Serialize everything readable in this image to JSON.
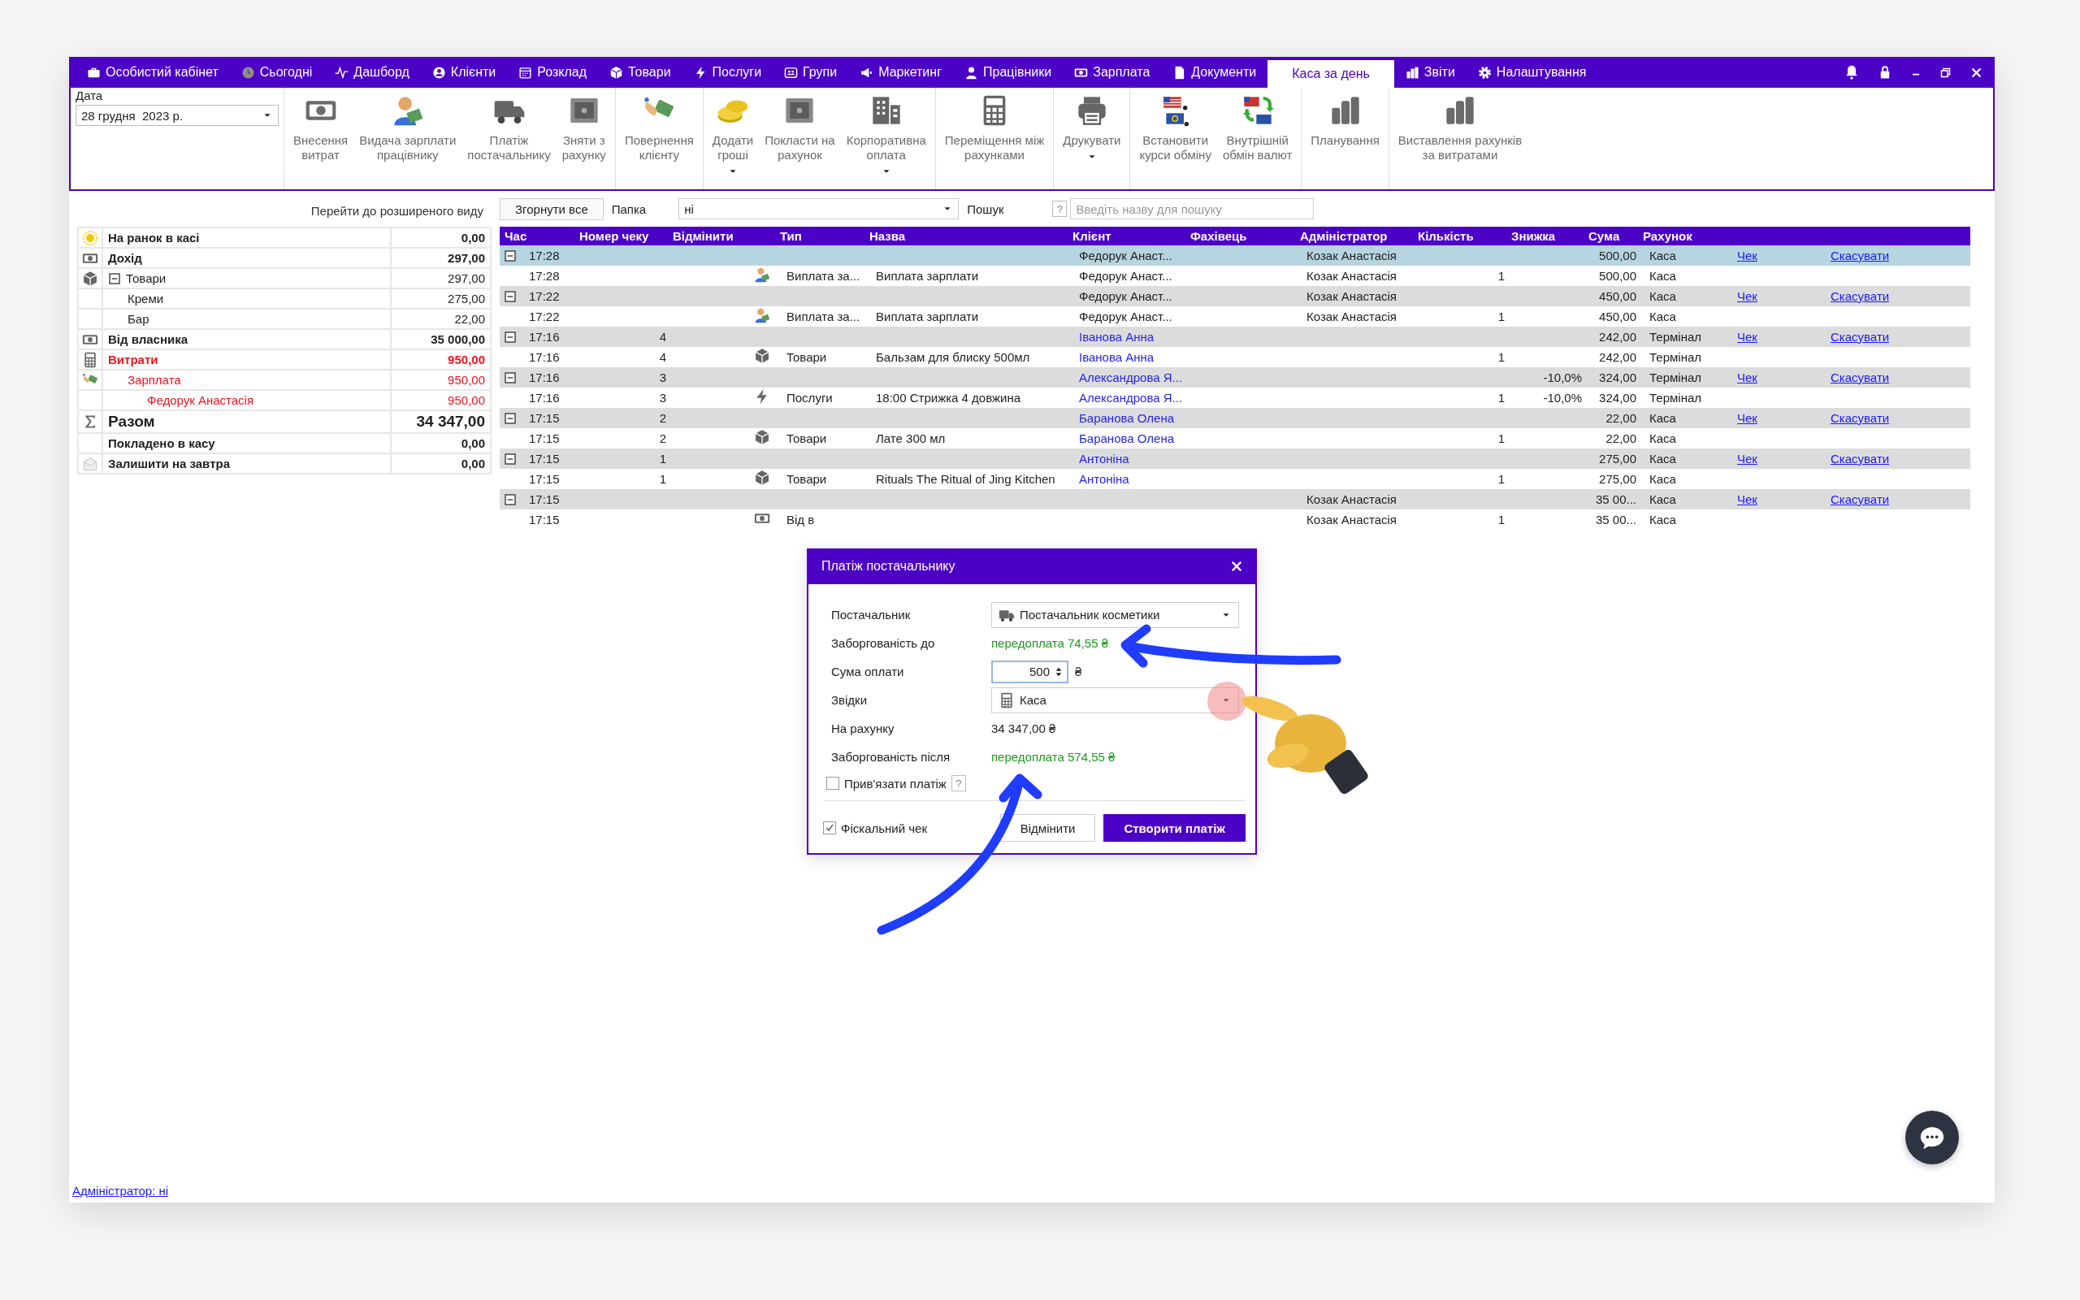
{
  "nav": [
    {
      "label": "Особистий кабінет",
      "selected": false
    },
    {
      "label": "Сьогодні",
      "selected": false
    },
    {
      "label": "Дашборд",
      "selected": false
    },
    {
      "label": "Клієнти",
      "selected": false
    },
    {
      "label": "Розклад",
      "selected": false
    },
    {
      "label": "Товари",
      "selected": false
    },
    {
      "label": "Послуги",
      "selected": false
    },
    {
      "label": "Групи",
      "selected": false
    },
    {
      "label": "Маркетинг",
      "selected": false
    },
    {
      "label": "Працівники",
      "selected": false
    },
    {
      "label": "Зарплата",
      "selected": false
    },
    {
      "label": "Документи",
      "selected": false
    },
    {
      "label": "Каса за день",
      "selected": true
    },
    {
      "label": "Звіти",
      "selected": false
    },
    {
      "label": "Налаштування",
      "selected": false
    }
  ],
  "toolbar": {
    "date_label": "Дата",
    "date": "28 грудня  2023 р.",
    "groups": [
      [
        {
          "label": "Внесення\nвитрат",
          "dropdown": false
        },
        {
          "label": "Видача зарплати\nпрацівнику",
          "dropdown": false
        },
        {
          "label": "Платіж\nпостачальнику",
          "dropdown": false
        },
        {
          "label": "Зняти з\nрахунку",
          "dropdown": false
        }
      ],
      [
        {
          "label": "Повернення\nклієнту",
          "dropdown": false
        }
      ],
      [
        {
          "label": "Додати\nгроші",
          "dropdown": true
        },
        {
          "label": "Покласти на\nрахунок",
          "dropdown": false
        },
        {
          "label": "Корпоративна\nоплата",
          "dropdown": true
        }
      ],
      [
        {
          "label": "Переміщення між\nрахунками",
          "dropdown": false
        }
      ],
      [
        {
          "label": "Друкувати",
          "dropdown": true
        }
      ],
      [
        {
          "label": "Встановити\nкурси обміну",
          "dropdown": false
        },
        {
          "label": "Внутрішній\nобмін валют",
          "dropdown": false
        }
      ],
      [
        {
          "label": "Планування",
          "dropdown": false
        }
      ],
      [
        {
          "label": "Виставлення рахунків\nза витратами",
          "dropdown": false
        }
      ]
    ]
  },
  "extended_view_link": "Перейти до розширеного виду",
  "summary": {
    "rows": [
      {
        "kind": "line",
        "label": "На ранок в касі",
        "value": "0,00",
        "bold": true,
        "red": false
      },
      {
        "kind": "line",
        "label": "Дохід",
        "value": "297,00",
        "bold": true,
        "red": false
      },
      {
        "kind": "line",
        "label": "Товари",
        "value": "297,00",
        "bold": false,
        "red": false,
        "expanded": true,
        "children": [
          {
            "kind": "line",
            "label": "Креми",
            "value": "275,00",
            "bold": false,
            "red": false
          },
          {
            "kind": "line",
            "label": "Бар",
            "value": "22,00",
            "bold": false,
            "red": false
          }
        ]
      },
      {
        "kind": "line",
        "label": "Від власника",
        "value": "35 000,00",
        "bold": true,
        "red": false
      },
      {
        "kind": "line",
        "label": "Витрати",
        "value": "950,00",
        "bold": true,
        "red": true,
        "children": [
          {
            "kind": "line",
            "label": "Зарплата",
            "value": "950,00",
            "bold": false,
            "red": true,
            "children": [
              {
                "kind": "line",
                "label": "Федорук Анастасія",
                "value": "950,00",
                "bold": false,
                "red": true
              }
            ]
          }
        ]
      },
      {
        "kind": "total",
        "label": "Разом",
        "value": "34 347,00",
        "bold": true,
        "red": false
      },
      {
        "kind": "line",
        "label": "Покладено в касу",
        "value": "0,00",
        "bold": true,
        "red": false
      },
      {
        "kind": "line",
        "label": "Залишити на завтра",
        "value": "0,00",
        "bold": true,
        "red": false
      }
    ]
  },
  "filter": {
    "collapse_all": "Згорнути все",
    "folder_label": "Папка",
    "folder": "ні",
    "search_label": "Пошук",
    "help": "?",
    "search_placeholder": "Введіть назву для пошуку"
  },
  "table": {
    "columns": [
      "Час",
      "Номер чеку",
      "Відмінити",
      "Тип",
      "Назва",
      "Клієнт",
      "Фахівець",
      "Адміністратор",
      "Кількість",
      "Знижка",
      "Сума",
      "Рахунок"
    ],
    "rows": [
      {
        "kind": "group",
        "expanded": true,
        "selected": true,
        "time": "17:28",
        "client": "Федорук Анаст...",
        "client_linked": false,
        "admin": "Козак Анастасія",
        "sum": "500,00",
        "account": "Каса",
        "check": "Чек",
        "cancel": "Скасувати"
      },
      {
        "kind": "item",
        "selected": false,
        "time": "17:28",
        "type": "Виплата за...",
        "name": "Виплата зарплати",
        "client": "Федорук Анаст...",
        "client_linked": false,
        "admin": "Козак Анастасія",
        "qty": "1",
        "sum": "500,00",
        "account": "Каса"
      },
      {
        "kind": "group",
        "expanded": true,
        "selected": false,
        "time": "17:22",
        "client": "Федорук Анаст...",
        "client_linked": false,
        "admin": "Козак Анастасія",
        "sum": "450,00",
        "account": "Каса",
        "check": "Чек",
        "cancel": "Скасувати"
      },
      {
        "kind": "item",
        "selected": false,
        "time": "17:22",
        "type": "Виплата за...",
        "name": "Виплата зарплати",
        "client": "Федорук Анаст...",
        "client_linked": false,
        "admin": "Козак Анастасія",
        "qty": "1",
        "sum": "450,00",
        "account": "Каса"
      },
      {
        "kind": "group",
        "expanded": true,
        "selected": false,
        "time": "17:16",
        "receipt": "4",
        "client": "Іванова Анна",
        "client_linked": true,
        "sum": "242,00",
        "account": "Термінал",
        "check": "Чек",
        "cancel": "Скасувати"
      },
      {
        "kind": "item",
        "selected": false,
        "time": "17:16",
        "receipt": "4",
        "type": "Товари",
        "name": "Бальзам для блиску 500мл",
        "client": "Іванова Анна",
        "client_linked": true,
        "qty": "1",
        "sum": "242,00",
        "account": "Термінал"
      },
      {
        "kind": "group",
        "expanded": true,
        "selected": false,
        "time": "17:16",
        "receipt": "3",
        "client": "Александрова Я...",
        "client_linked": true,
        "discount": "-10,0%",
        "sum": "324,00",
        "account": "Термінал",
        "check": "Чек",
        "cancel": "Скасувати"
      },
      {
        "kind": "item",
        "selected": false,
        "time": "17:16",
        "receipt": "3",
        "type": "Послуги",
        "name": "18:00 Стрижка 4 довжина",
        "client": "Александрова Я...",
        "client_linked": true,
        "qty": "1",
        "discount": "-10,0%",
        "sum": "324,00",
        "account": "Термінал"
      },
      {
        "kind": "group",
        "expanded": true,
        "selected": false,
        "time": "17:15",
        "receipt": "2",
        "client": "Баранова Олена",
        "client_linked": true,
        "sum": "22,00",
        "account": "Каса",
        "check": "Чек",
        "cancel": "Скасувати"
      },
      {
        "kind": "item",
        "selected": false,
        "time": "17:15",
        "receipt": "2",
        "type": "Товари",
        "name": "Лате 300 мл",
        "client": "Баранова Олена",
        "client_linked": true,
        "qty": "1",
        "sum": "22,00",
        "account": "Каса"
      },
      {
        "kind": "group",
        "expanded": true,
        "selected": false,
        "time": "17:15",
        "receipt": "1",
        "client": "Антоніна",
        "client_linked": true,
        "sum": "275,00",
        "account": "Каса",
        "check": "Чек",
        "cancel": "Скасувати"
      },
      {
        "kind": "item",
        "selected": false,
        "time": "17:15",
        "receipt": "1",
        "type": "Товари",
        "name": "Rituals The Ritual of Jing Kitchen",
        "client": "Антоніна",
        "client_linked": true,
        "qty": "1",
        "sum": "275,00",
        "account": "Каса"
      },
      {
        "kind": "group",
        "expanded": true,
        "selected": false,
        "time": "17:15",
        "admin": "Козак Анастасія",
        "sum": "35 00...",
        "account": "Каса",
        "check": "Чек",
        "cancel": "Скасувати"
      },
      {
        "kind": "item",
        "selected": false,
        "time": "17:15",
        "type": "Від в",
        "admin": "Козак Анастасія",
        "qty": "1",
        "sum": "35 00...",
        "account": "Каса"
      }
    ]
  },
  "dialog": {
    "title": "Платіж постачальнику",
    "fields": [
      {
        "kind": "select",
        "label": "Постачальник",
        "value": "Постачальник косметики"
      },
      {
        "kind": "note",
        "label": "Заборгованість до",
        "value": "передоплата 74,55 ₴"
      },
      {
        "kind": "spin",
        "label": "Сума оплати",
        "value": "500",
        "unit": "₴"
      },
      {
        "kind": "select",
        "label": "Звідки",
        "value": "Каса"
      },
      {
        "kind": "text",
        "label": "На рахунку",
        "value": "34 347,00 ₴"
      },
      {
        "kind": "note",
        "label": "Заборгованість після",
        "value": "передоплата 574,55 ₴"
      }
    ],
    "bind_payment": {
      "label": "Прив'язати платіж",
      "checked": false,
      "help": "?"
    },
    "fiscal_receipt": {
      "label": "Фіскальний чек",
      "checked": true
    },
    "buttons": [
      {
        "label": "Відмінити",
        "primary": false
      },
      {
        "label": "Створити платіж",
        "primary": true
      }
    ]
  },
  "admin_link": "Адміністратор: ні"
}
